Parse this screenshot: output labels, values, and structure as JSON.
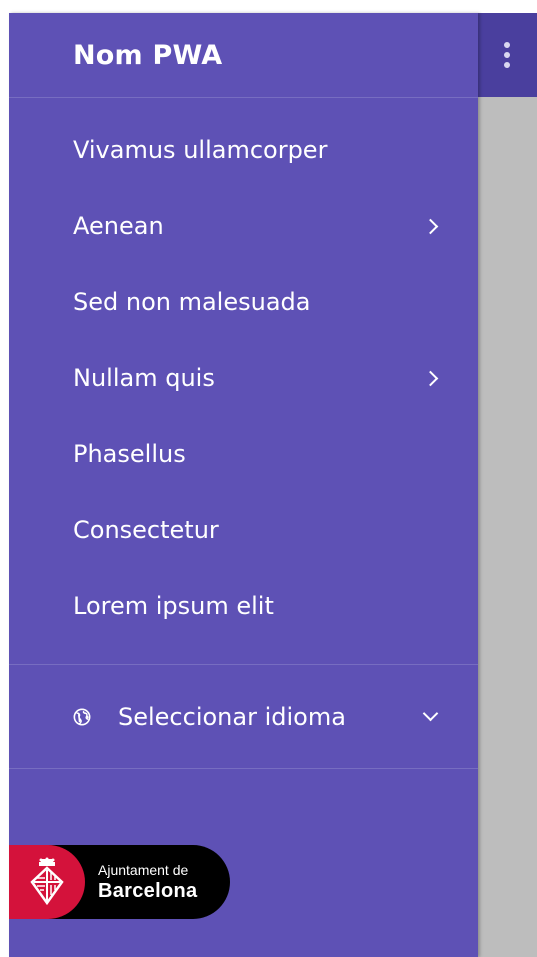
{
  "colors": {
    "drawer_bg": "#5e51b5",
    "topbar_bg": "#4a3f9e",
    "scrim": "#bdbdbd",
    "logo_red": "#d4123b"
  },
  "app": {
    "overflow_menu_icon": "kebab-menu-icon"
  },
  "drawer": {
    "title": "Nom PWA",
    "items": [
      {
        "label": "Vivamus ullamcorper",
        "has_submenu": false
      },
      {
        "label": "Aenean",
        "has_submenu": true,
        "icon": "chevron-right-icon"
      },
      {
        "label": "Sed non malesuada",
        "has_submenu": false
      },
      {
        "label": "Nullam quis",
        "has_submenu": true,
        "icon": "chevron-right-icon"
      },
      {
        "label": "Phasellus",
        "has_submenu": false
      },
      {
        "label": "Consectetur",
        "has_submenu": false
      },
      {
        "label": "Lorem ipsum elit",
        "has_submenu": false
      }
    ],
    "language": {
      "icon": "globe-icon",
      "label": "Seleccionar idioma",
      "toggle_icon": "chevron-down-icon"
    },
    "logo": {
      "line1": "Ajuntament de",
      "line2": "Barcelona"
    }
  }
}
